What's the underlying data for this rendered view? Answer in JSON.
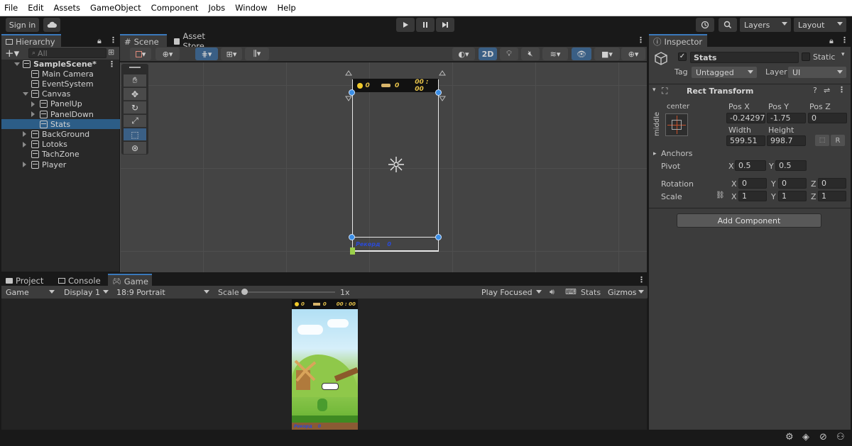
{
  "menu": [
    "File",
    "Edit",
    "Assets",
    "GameObject",
    "Component",
    "Jobs",
    "Window",
    "Help"
  ],
  "toolbar": {
    "sign_in": "Sign in",
    "layers": "Layers",
    "layout": "Layout"
  },
  "hierarchy": {
    "tab": "Hierarchy",
    "search_placeholder": "All",
    "items": [
      {
        "label": "SampleScene*",
        "indent": 0,
        "fold": "d",
        "kind": "scene"
      },
      {
        "label": "Main Camera",
        "indent": 1,
        "fold": "",
        "kind": "obj"
      },
      {
        "label": "EventSystem",
        "indent": 1,
        "fold": "",
        "kind": "obj"
      },
      {
        "label": "Canvas",
        "indent": 1,
        "fold": "d",
        "kind": "obj"
      },
      {
        "label": "PanelUp",
        "indent": 2,
        "fold": "r",
        "kind": "obj"
      },
      {
        "label": "PanelDown",
        "indent": 2,
        "fold": "r",
        "kind": "obj"
      },
      {
        "label": "Stats",
        "indent": 2,
        "fold": "",
        "kind": "obj",
        "selected": true
      },
      {
        "label": "BackGround",
        "indent": 1,
        "fold": "r",
        "kind": "obj"
      },
      {
        "label": "Lotoks",
        "indent": 1,
        "fold": "r",
        "kind": "obj"
      },
      {
        "label": "TachZone",
        "indent": 1,
        "fold": "",
        "kind": "obj"
      },
      {
        "label": "Player",
        "indent": 1,
        "fold": "r",
        "kind": "obj"
      }
    ]
  },
  "scene": {
    "tabs": [
      "Scene",
      "Asset Store"
    ],
    "mode_2d": "2D",
    "hud_top": {
      "coins": "0",
      "score": "0",
      "time": "00 : 00"
    },
    "hud_bottom": {
      "label": "Рекорд",
      "value": "0"
    }
  },
  "bottom": {
    "tabs": [
      "Project",
      "Console",
      "Game"
    ],
    "game_dropdown": "Game",
    "display": "Display 1",
    "aspect": "18:9 Portrait",
    "scale_label": "Scale",
    "scale_value": "1x",
    "play_focused": "Play Focused",
    "stats": "Stats",
    "gizmos": "Gizmos",
    "preview_top": {
      "coins": "0",
      "score": "0",
      "time": "00 : 00"
    },
    "preview_bottom": {
      "label": "Рекорд",
      "value": "0"
    }
  },
  "inspector": {
    "tab": "Inspector",
    "object_name": "Stats",
    "static_label": "Static",
    "tag_label": "Tag",
    "tag_value": "Untagged",
    "layer_label": "Layer",
    "layer_value": "UI",
    "component_title": "Rect Transform",
    "anchor_h": "center",
    "anchor_v": "middle",
    "pos_x_label": "Pos X",
    "pos_x": "-0.24297",
    "pos_y_label": "Pos Y",
    "pos_y": "-1.75",
    "pos_z_label": "Pos Z",
    "pos_z": "0",
    "width_label": "Width",
    "width": "599.51",
    "height_label": "Height",
    "height": "998.7",
    "r_button": "R",
    "anchors_label": "Anchors",
    "pivot_label": "Pivot",
    "pivot_x": "0.5",
    "pivot_y": "0.5",
    "rotation_label": "Rotation",
    "rot_x": "0",
    "rot_y": "0",
    "rot_z": "0",
    "scale_label": "Scale",
    "scale_x": "1",
    "scale_y": "1",
    "scale_z": "1",
    "axis_x": "X",
    "axis_y": "Y",
    "axis_z": "Z",
    "add_component": "Add Component"
  },
  "colors": {
    "selection": "#2c5d87",
    "accent": "#3a79bb",
    "panel": "#282828"
  }
}
